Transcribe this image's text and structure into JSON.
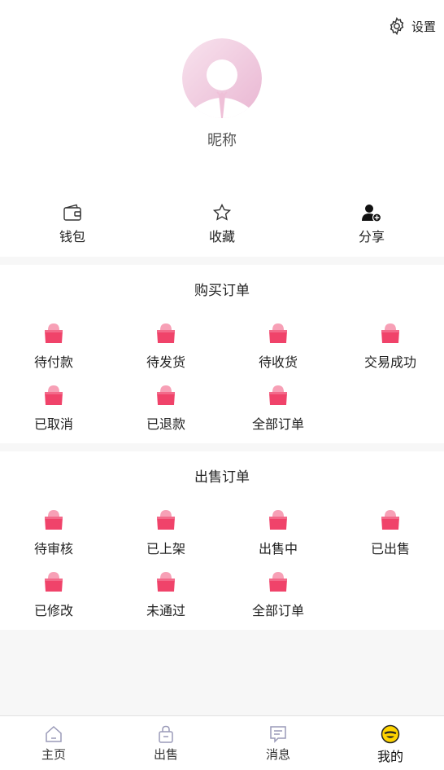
{
  "header": {
    "settings_label": "设置"
  },
  "profile": {
    "nickname": "昵称"
  },
  "quick_actions": [
    {
      "label": "钱包",
      "icon": "wallet-icon"
    },
    {
      "label": "收藏",
      "icon": "star-icon"
    },
    {
      "label": "分享",
      "icon": "add-user-icon"
    }
  ],
  "buy_orders": {
    "title": "购买订单",
    "items": [
      "待付款",
      "待发货",
      "待收货",
      "交易成功",
      "已取消",
      "已退款",
      "全部订单"
    ]
  },
  "sell_orders": {
    "title": "出售订单",
    "items": [
      "待审核",
      "已上架",
      "出售中",
      "已出售",
      "已修改",
      "未通过",
      "全部订单"
    ]
  },
  "tabbar": {
    "items": [
      {
        "label": "主页",
        "icon": "home-icon"
      },
      {
        "label": "出售",
        "icon": "lock-bag-icon"
      },
      {
        "label": "消息",
        "icon": "message-icon"
      },
      {
        "label": "我的",
        "icon": "smiley-icon"
      }
    ],
    "active": "我的"
  },
  "colors": {
    "accent": "#f0436a",
    "avatar": "#efc0d8"
  }
}
